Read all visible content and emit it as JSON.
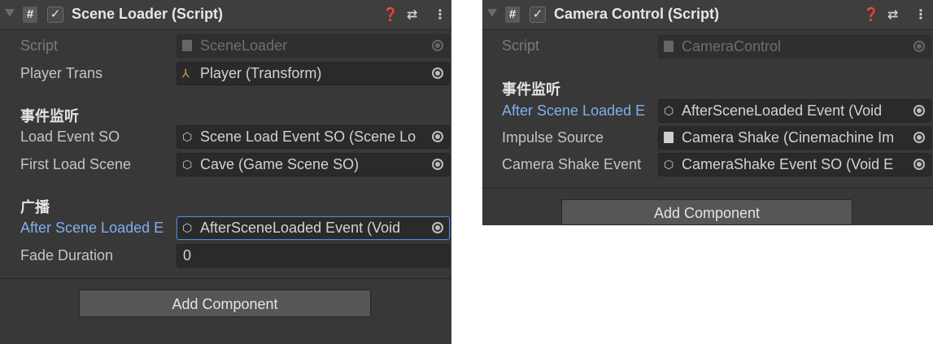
{
  "left": {
    "title": "Scene Loader (Script)",
    "header_icons": {
      "help": "❓",
      "settings": "⇄",
      "menu": "⋮"
    },
    "script": {
      "label": "Script",
      "value": "SceneLoader"
    },
    "player_trans": {
      "label": "Player Trans",
      "value": "Player (Transform)"
    },
    "section_events": "事件监听",
    "load_event_so": {
      "label": "Load Event SO",
      "value": "Scene Load Event SO (Scene Lo"
    },
    "first_load_scene": {
      "label": "First Load Scene",
      "value": "Cave (Game Scene SO)"
    },
    "section_broadcast": "广播",
    "after_scene_loaded": {
      "label": "After Scene Loaded E",
      "value": "AfterSceneLoaded Event (Void"
    },
    "fade_duration": {
      "label": "Fade Duration",
      "value": "0"
    },
    "add_component": "Add Component"
  },
  "right": {
    "title": "Camera Control (Script)",
    "script": {
      "label": "Script",
      "value": "CameraControl"
    },
    "section_events": "事件监听",
    "after_scene_loaded": {
      "label": "After Scene Loaded E",
      "value": "AfterSceneLoaded Event (Void"
    },
    "impulse_source": {
      "label": "Impulse Source",
      "value": "Camera Shake (Cinemachine Im"
    },
    "camera_shake_event": {
      "label": "Camera Shake Event",
      "value": "CameraShake Event SO (Void E"
    },
    "add_component": "Add Component"
  },
  "colors": {
    "panel_bg": "#383838",
    "field_bg": "#2a2a2a",
    "accent_blue": "#7fb0ec",
    "selection_border": "#4d8fe8"
  },
  "icons": [
    "foldout-caret-icon",
    "csharp-script-icon",
    "checkbox-icon",
    "help-icon",
    "presets-icon",
    "kebab-menu-icon",
    "transform-axis-icon",
    "scriptable-object-icon",
    "object-picker-icon"
  ]
}
